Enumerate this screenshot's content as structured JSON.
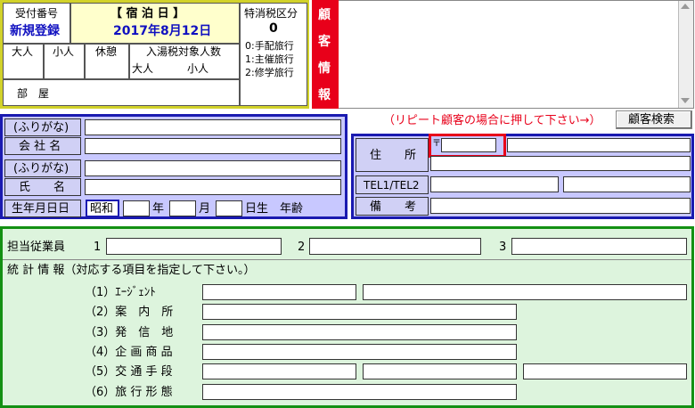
{
  "reservation": {
    "receipt_label": "受付番号",
    "receipt_value": "新規登録",
    "stay_date_label": "【 宿 泊 日 】",
    "stay_date": "2017年8月12日",
    "tax_label": "特消税区分",
    "tax_value": "0",
    "tax_options": [
      "0:手配旅行",
      "1:主催旅行",
      "2:修学旅行"
    ],
    "adult_label": "大人",
    "child_label": "小人",
    "rest_label": "休憩",
    "bath_tax_label": "入湯税対象人数",
    "bath_adult_label": "大人",
    "bath_child_label": "小人",
    "room_label": "部　屋"
  },
  "guest_info": {
    "side_chars": [
      "顧",
      "客",
      "情",
      "報"
    ]
  },
  "repeat_note": "（リピート顧客の場合に押して下さい→）",
  "customer_search_button": "顧客検索",
  "left_form": {
    "furigana1": "(ふりがな)",
    "company": "会 社 名",
    "furigana2": "(ふりがな)",
    "name": "氏　　名",
    "birthday": "生年月日日",
    "era": "昭和",
    "year": "年",
    "month": "月",
    "day_age": "日生　年齢"
  },
  "right_form": {
    "address": "住　　所",
    "postal_mark": "〒",
    "tel": "TEL1/TEL2",
    "notes": "備　　考"
  },
  "staff": {
    "label": "担当従業員",
    "slots": [
      "1",
      "2",
      "3"
    ]
  },
  "stats": {
    "heading": "統 計 情 報（対応する項目を指定して下さい。）",
    "items": [
      "（1）ｴｰｼﾞｪﾝﾄ",
      "（2）案　内　所",
      "（3）発　信　地",
      "（4）企 画 商 品",
      "（5）交 通 手 段",
      "（6）旅 行 形 態"
    ]
  },
  "colors": {
    "yellow_border": "#d2d22a",
    "blue_border": "#1a1ab0",
    "green_border": "#139013",
    "red_side": "#e8001a",
    "title_blue": "#1010c0",
    "note_red": "#e8001a"
  }
}
